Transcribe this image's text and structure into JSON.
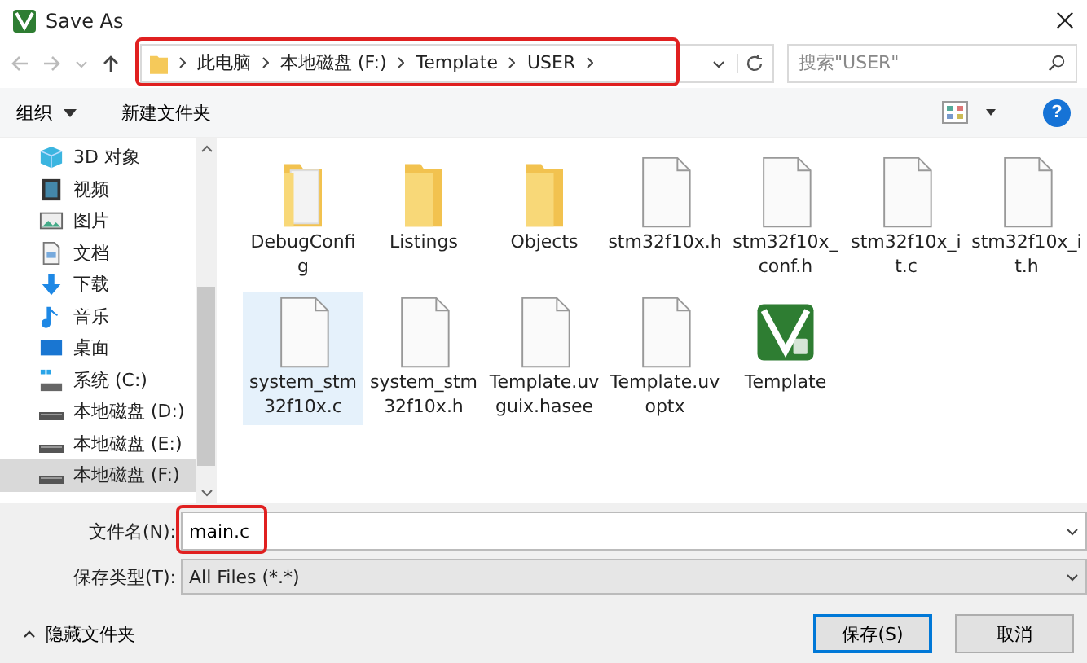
{
  "window": {
    "title": "Save As"
  },
  "address": {
    "crumbs": [
      "此电脑",
      "本地磁盘 (F:)",
      "Template",
      "USER"
    ],
    "highlighted": true
  },
  "search": {
    "placeholder": "搜索\"USER\""
  },
  "toolbar": {
    "organize": "组织",
    "new_folder": "新建文件夹",
    "help": "?"
  },
  "sidebar": {
    "items": [
      {
        "label": "3D 对象",
        "kind": "cube",
        "selected": false
      },
      {
        "label": "视频",
        "kind": "video",
        "selected": false
      },
      {
        "label": "图片",
        "kind": "picture",
        "selected": false
      },
      {
        "label": "文档",
        "kind": "document",
        "selected": false
      },
      {
        "label": "下载",
        "kind": "download",
        "selected": false
      },
      {
        "label": "音乐",
        "kind": "music",
        "selected": false
      },
      {
        "label": "桌面",
        "kind": "desktop",
        "selected": false
      },
      {
        "label": "系统 (C:)",
        "kind": "system-drive",
        "selected": false
      },
      {
        "label": "本地磁盘 (D:)",
        "kind": "drive",
        "selected": false
      },
      {
        "label": "本地磁盘 (E:)",
        "kind": "drive",
        "selected": false
      },
      {
        "label": "本地磁盘 (F:)",
        "kind": "drive",
        "selected": true
      }
    ]
  },
  "files": [
    {
      "name": "DebugConfig",
      "kind": "folder-docs",
      "selected": false
    },
    {
      "name": "Listings",
      "kind": "folder",
      "selected": false
    },
    {
      "name": "Objects",
      "kind": "folder",
      "selected": false
    },
    {
      "name": "stm32f10x.h",
      "kind": "file",
      "selected": false
    },
    {
      "name": "stm32f10x_conf.h",
      "kind": "file",
      "selected": false
    },
    {
      "name": "stm32f10x_it.c",
      "kind": "file",
      "selected": false
    },
    {
      "name": "stm32f10x_it.h",
      "kind": "file",
      "selected": false
    },
    {
      "name": "system_stm32f10x.c",
      "kind": "file",
      "selected": true
    },
    {
      "name": "system_stm32f10x.h",
      "kind": "file",
      "selected": false
    },
    {
      "name": "Template.uvguix.hasee",
      "kind": "file",
      "selected": false
    },
    {
      "name": "Template.uvoptx",
      "kind": "file",
      "selected": false
    },
    {
      "name": "Template",
      "kind": "project",
      "selected": false
    }
  ],
  "filename": {
    "label": "文件名(N):",
    "value": "main.c",
    "highlighted": true
  },
  "filetype": {
    "label": "保存类型(T):",
    "value": "All Files (*.*)"
  },
  "hide_folders": "隐藏文件夹",
  "buttons": [
    "保存(S)",
    "取消"
  ]
}
